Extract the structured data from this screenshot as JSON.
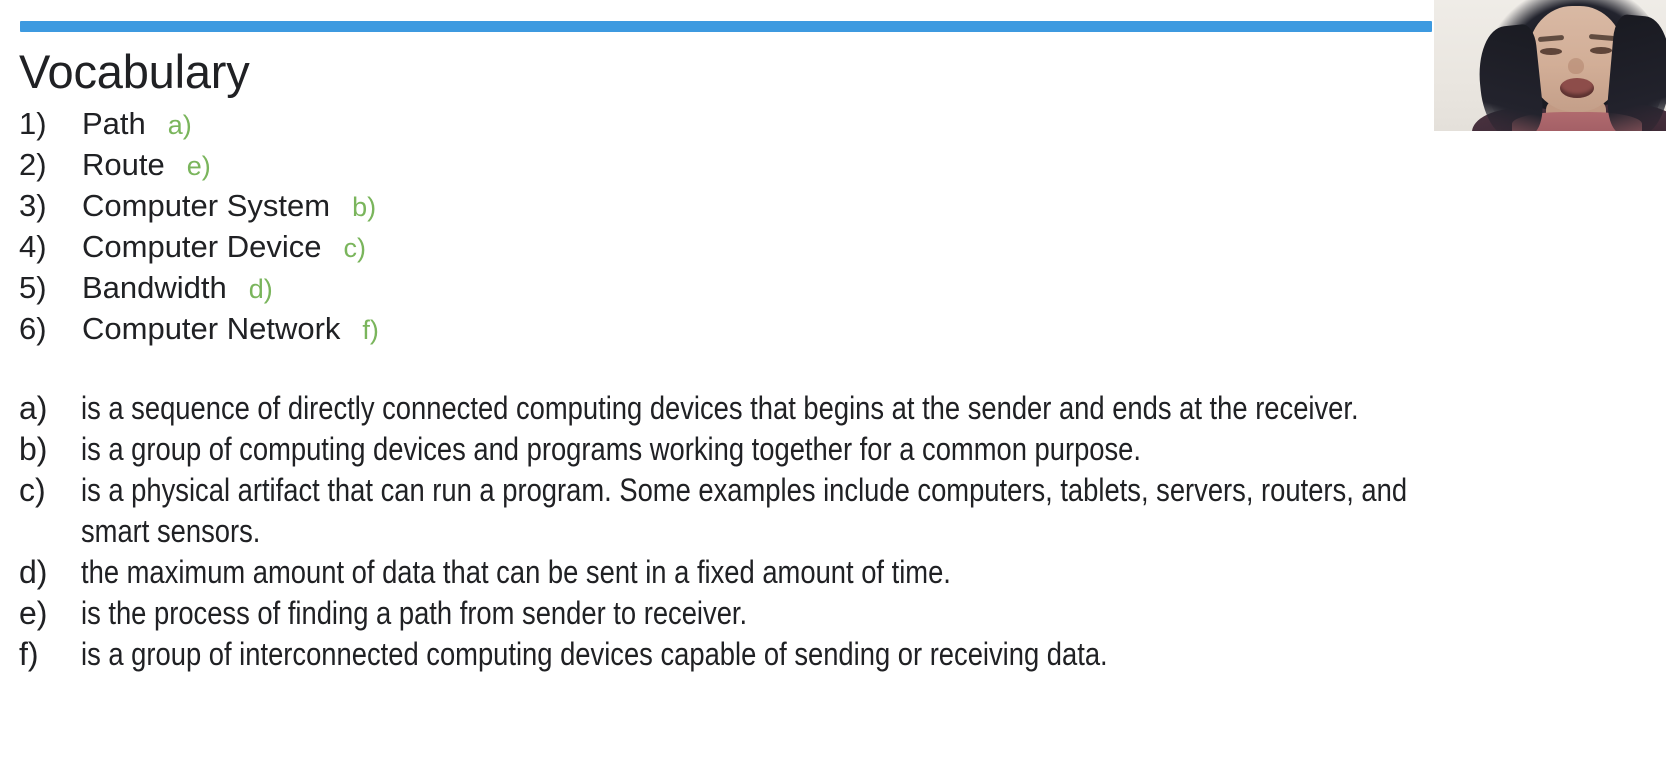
{
  "slide": {
    "title": "Vocabulary",
    "accent_color": "#3d9ae0",
    "answer_color": "#7ab55c",
    "text_color": "#202124",
    "background_color": "#ffffff"
  },
  "vocab_list": [
    {
      "number": "1)",
      "term": "Path",
      "answer": "a)"
    },
    {
      "number": "2)",
      "term": "Route",
      "answer": "e)"
    },
    {
      "number": "3)",
      "term": "Computer System",
      "answer": "b)"
    },
    {
      "number": "4)",
      "term": "Computer Device",
      "answer": "c)"
    },
    {
      "number": "5)",
      "term": "Bandwidth",
      "answer": "d)"
    },
    {
      "number": "6)",
      "term": "Computer Network",
      "answer": "f)"
    }
  ],
  "definitions": [
    {
      "letter": "a)",
      "text": "is a sequence of directly connected computing devices that begins at the sender and ends at the receiver."
    },
    {
      "letter": "b)",
      "text": "is a group of computing devices and programs working together for a common purpose."
    },
    {
      "letter": "c)",
      "text": "is a physical artifact that can run a program. Some examples include computers, tablets, servers, routers, and smart sensors."
    },
    {
      "letter": "d)",
      "text": "the maximum amount of data that can be sent in a fixed amount of time."
    },
    {
      "letter": "e)",
      "text": "is the process of finding a path from sender to receiver."
    },
    {
      "letter": "f)",
      "text": "is a group of interconnected computing devices capable of sending or receiving data."
    }
  ],
  "webcam": {
    "label": "presenter-webcam-feed"
  }
}
